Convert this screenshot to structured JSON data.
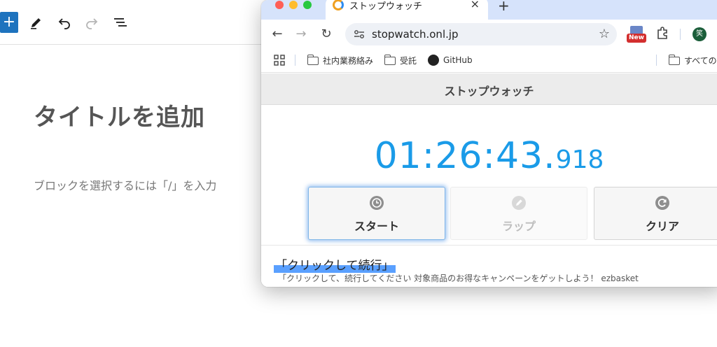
{
  "editor": {
    "add_label": "+",
    "title_placeholder": "タイトルを追加",
    "block_hint": "ブロックを選択するには「/」を入力"
  },
  "browser": {
    "tab": {
      "title": "ストップウォッチ",
      "close": "×"
    },
    "new_tab": "+",
    "nav": {
      "back": "←",
      "forward": "→",
      "reload": "↻",
      "star": "☆"
    },
    "url": "stopwatch.onl.jp",
    "extension_badge": "New",
    "avatar_initial": "笑",
    "bookmarks": [
      {
        "label": "社内業務絡み"
      },
      {
        "label": "受託"
      },
      {
        "label": "GitHub"
      },
      {
        "label": "すべての"
      }
    ]
  },
  "stopwatch": {
    "header": "ストップウォッチ",
    "time_main": "01:26:43.",
    "time_ms": "918",
    "buttons": {
      "start": "スタート",
      "lap": "ラップ",
      "clear": "クリア"
    }
  },
  "ad": {
    "title": "「クリックして続行」",
    "description": "「クリックして、続行してください 対象商品のお得なキャンペーンをゲットしよう！ ezbasket"
  },
  "colors": {
    "accent_blue": "#1a9be8",
    "editor_add": "#1e73be",
    "tab_strip": "#d6e3fb",
    "traffic_red": "#ff5f57",
    "traffic_yellow": "#febc2e",
    "traffic_green": "#28c840"
  }
}
